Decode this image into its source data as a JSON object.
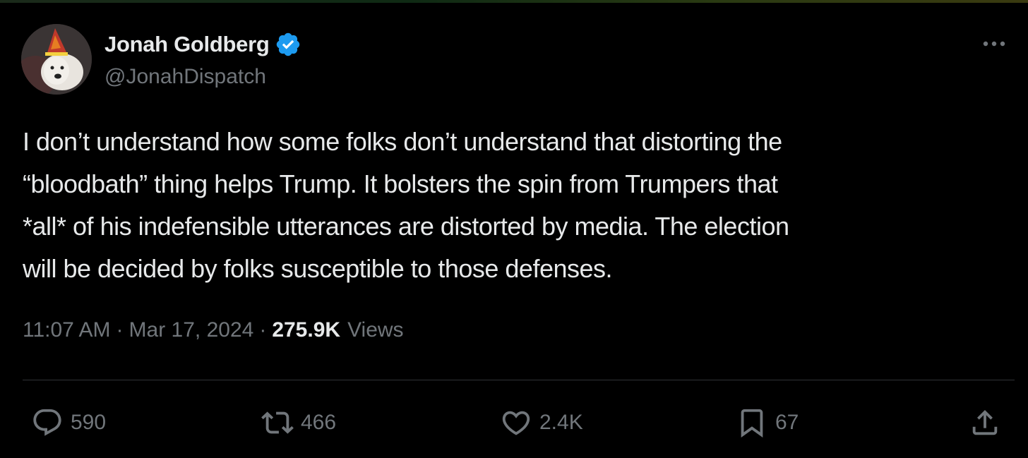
{
  "author": {
    "display_name": "Jonah Goldberg",
    "handle": "@JonahDispatch",
    "verified": true
  },
  "tweet": {
    "text_lines": [
      "I don’t understand how some folks don’t understand that distorting the",
      "“bloodbath” thing helps Trump. It bolsters the spin from Trumpers that",
      "*all* of his indefensible utterances are distorted by media.  The election",
      "will be decided by folks susceptible to those defenses."
    ],
    "time": "11:07 AM",
    "date": "Mar 17, 2024",
    "separator": "·",
    "views_count": "275.9K",
    "views_label": "Views"
  },
  "actions": {
    "replies": "590",
    "reposts": "466",
    "likes": "2.4K",
    "bookmarks": "67"
  },
  "icons": {
    "verified": "verified-badge-icon",
    "more": "more-dots-icon",
    "reply": "reply-bubble-icon",
    "repost": "repost-arrows-icon",
    "like": "heart-icon",
    "bookmark": "bookmark-icon",
    "share": "share-upload-icon"
  },
  "colors": {
    "background": "#000000",
    "text_primary": "#e7e9ea",
    "text_secondary": "#71767b",
    "verified_blue": "#1d9bf0",
    "divider": "#2f3336"
  }
}
